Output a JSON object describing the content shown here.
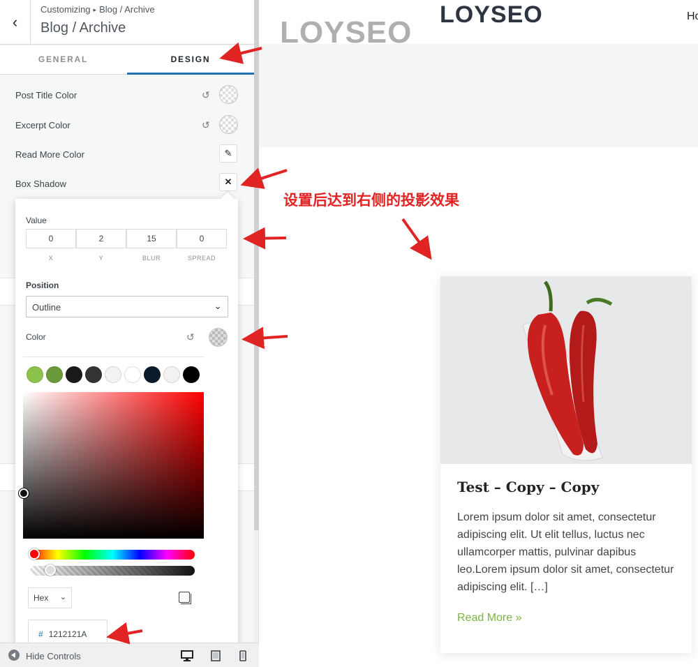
{
  "header": {
    "back_icon": "chevron-left-icon",
    "breadcrumb_root": "Customizing",
    "breadcrumb_sep": "▸",
    "breadcrumb_section": "Blog / Archive",
    "title": "Blog / Archive"
  },
  "tabs": [
    {
      "label": "GENERAL",
      "active": false
    },
    {
      "label": "DESIGN",
      "active": true
    }
  ],
  "options": {
    "post_title_color": "Post Title Color",
    "excerpt_color": "Excerpt Color",
    "read_more_color": "Read More Color",
    "box_shadow": "Box Shadow"
  },
  "popover": {
    "value_label": "Value",
    "values": [
      {
        "value": "0",
        "caption": "X"
      },
      {
        "value": "2",
        "caption": "Y"
      },
      {
        "value": "15",
        "caption": "BLUR"
      },
      {
        "value": "0",
        "caption": "SPREAD"
      }
    ],
    "position_label": "Position",
    "position_value": "Outline",
    "color_label": "Color",
    "palette": [
      "#8bc34a",
      "#6a9a3a",
      "#1a1a1a",
      "#333333",
      "#f5f3f1",
      "#ffffff",
      "#0b1a2b",
      "#f3f2f0",
      "#000000"
    ],
    "format_value": "Hex",
    "hex_value": "1212121A"
  },
  "footer": {
    "hide_controls": "Hide Controls"
  },
  "preview": {
    "logo": "LOYSEO",
    "nav_item": "Ho",
    "watermark": "LOYSEO",
    "annotation": "设置后达到右侧的投影效果",
    "card": {
      "title": "Test – Copy – Copy",
      "excerpt": "Lorem ipsum dolor sit amet, consectetur adipiscing elit. Ut elit tellus, luctus nec ullamcorper mattis, pulvinar dapibus leo.Lorem ipsum dolor sit amet, consectetur adipiscing elit. […]",
      "read_more": "Read More »"
    }
  },
  "colors": {
    "accent": "#2271b1",
    "annotation_red": "#e02424",
    "read_more_green": "#7cb342"
  }
}
